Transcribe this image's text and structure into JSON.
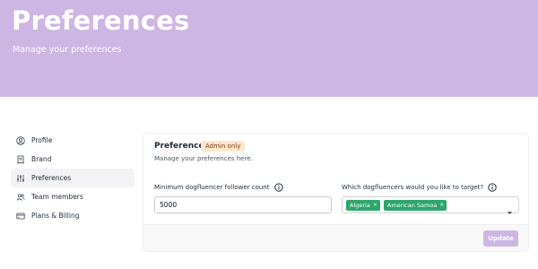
{
  "header": {
    "title": "Preferences",
    "subtitle": "Manage your preferences",
    "background_color": "#cdb6e3"
  },
  "sidebar": {
    "items": [
      {
        "label": "Profile",
        "icon": "user-circle-icon",
        "active": false
      },
      {
        "label": "Brand",
        "icon": "receipt-icon",
        "active": false
      },
      {
        "label": "Preferences",
        "icon": "sliders-icon",
        "active": true
      },
      {
        "label": "Team members",
        "icon": "users-icon",
        "active": false
      },
      {
        "label": "Plans & Billing",
        "icon": "credit-card-icon",
        "active": false
      }
    ]
  },
  "card": {
    "title": "Preferences",
    "badge": "Admin only",
    "description": "Manage your preferences here.",
    "follower_field": {
      "label": "Minimum dogfluencer follower count",
      "value": "5000",
      "info_icon": "info-circle-icon"
    },
    "target_field": {
      "label": "Which dogfluencers would you like to target?",
      "info_icon": "info-circle-icon",
      "selected": [
        {
          "label": "Algeria",
          "remove": "×"
        },
        {
          "label": "American Samoa",
          "remove": "×"
        }
      ],
      "chip_color": "#2da56b",
      "dropdown_icon": "chevron-down-icon"
    },
    "update_label": "Update",
    "badge_color": "#fde6cc"
  }
}
